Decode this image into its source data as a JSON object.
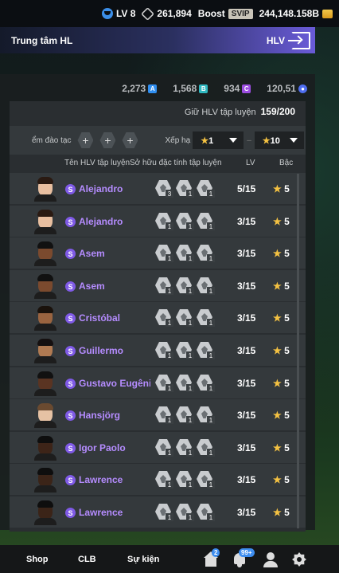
{
  "topbar": {
    "level": "LV 8",
    "hex_count": "261,894",
    "boost_label": "Boost",
    "svip_label": "SVIP",
    "coins": "244,148.158B"
  },
  "header": {
    "title": "Trung tâm HL",
    "right_label": "HLV"
  },
  "currency": [
    {
      "value": "2,273",
      "icon": "A",
      "color": "#2f8ef0"
    },
    {
      "value": "1,568",
      "icon": "B",
      "color": "#2fb8c0"
    },
    {
      "value": "934",
      "icon": "C",
      "color": "#9b4de0"
    },
    {
      "value": "120,51",
      "icon": "token",
      "color": "#4f6ef0"
    }
  ],
  "keep": {
    "label": "Giữ HLV tập luyện",
    "value": "159/200"
  },
  "filters": {
    "slot_label": "ểm đào tạc",
    "sort_label": "Xếp hạ",
    "grade_from": "1",
    "grade_to": "10",
    "dash": "–"
  },
  "columns": {
    "name": "Tên HLV tập luyện",
    "traits": "Sở hữu đặc tính tập luyện",
    "lv": "LV",
    "grade": "Bậc"
  },
  "coaches": [
    {
      "name": "Alejandro",
      "lv": "5/15",
      "grade": "5",
      "skin": "#e8bfa0",
      "hair": "#2a1a12",
      "trait_levels": [
        "3",
        "1",
        "1"
      ]
    },
    {
      "name": "Alejandro",
      "lv": "3/15",
      "grade": "5",
      "skin": "#e8bfa0",
      "hair": "#2a1a12",
      "trait_levels": [
        "1",
        "1",
        "1"
      ]
    },
    {
      "name": "Asem",
      "lv": "3/15",
      "grade": "5",
      "skin": "#7b4a2e",
      "hair": "#111",
      "trait_levels": [
        "1",
        "1",
        "1"
      ]
    },
    {
      "name": "Asem",
      "lv": "3/15",
      "grade": "5",
      "skin": "#7b4a2e",
      "hair": "#111",
      "trait_levels": [
        "1",
        "1",
        "1"
      ]
    },
    {
      "name": "Cristóbal",
      "lv": "3/15",
      "grade": "5",
      "skin": "#9a6440",
      "hair": "#1a120c",
      "trait_levels": [
        "1",
        "1",
        "1"
      ]
    },
    {
      "name": "Guillermo",
      "lv": "3/15",
      "grade": "5",
      "skin": "#b07a52",
      "hair": "#151010",
      "trait_levels": [
        "1",
        "1",
        "1"
      ]
    },
    {
      "name": "Gustavo Eugênio",
      "lv": "3/15",
      "grade": "5",
      "skin": "#5a3422",
      "hair": "#111",
      "trait_levels": [
        "1",
        "1",
        "1"
      ]
    },
    {
      "name": "Hansjörg",
      "lv": "3/15",
      "grade": "5",
      "skin": "#e6c2a4",
      "hair": "#6a4a30",
      "trait_levels": [
        "1",
        "1",
        "1"
      ]
    },
    {
      "name": "Igor Paolo",
      "lv": "3/15",
      "grade": "5",
      "skin": "#3d2418",
      "hair": "#0e0e0e",
      "trait_levels": [
        "1",
        "1",
        "1"
      ]
    },
    {
      "name": "Lawrence",
      "lv": "3/15",
      "grade": "5",
      "skin": "#3b2418",
      "hair": "#0e0e0e",
      "trait_levels": [
        "1",
        "1",
        "1"
      ]
    },
    {
      "name": "Lawrence",
      "lv": "3/15",
      "grade": "5",
      "skin": "#3b2418",
      "hair": "#0e0e0e",
      "trait_levels": [
        "1",
        "1",
        "1"
      ]
    }
  ],
  "bottom": {
    "shop": "Shop",
    "club": "CLB",
    "event": "Sự kiện",
    "home_badge": "2",
    "bell_badge": "99+"
  }
}
